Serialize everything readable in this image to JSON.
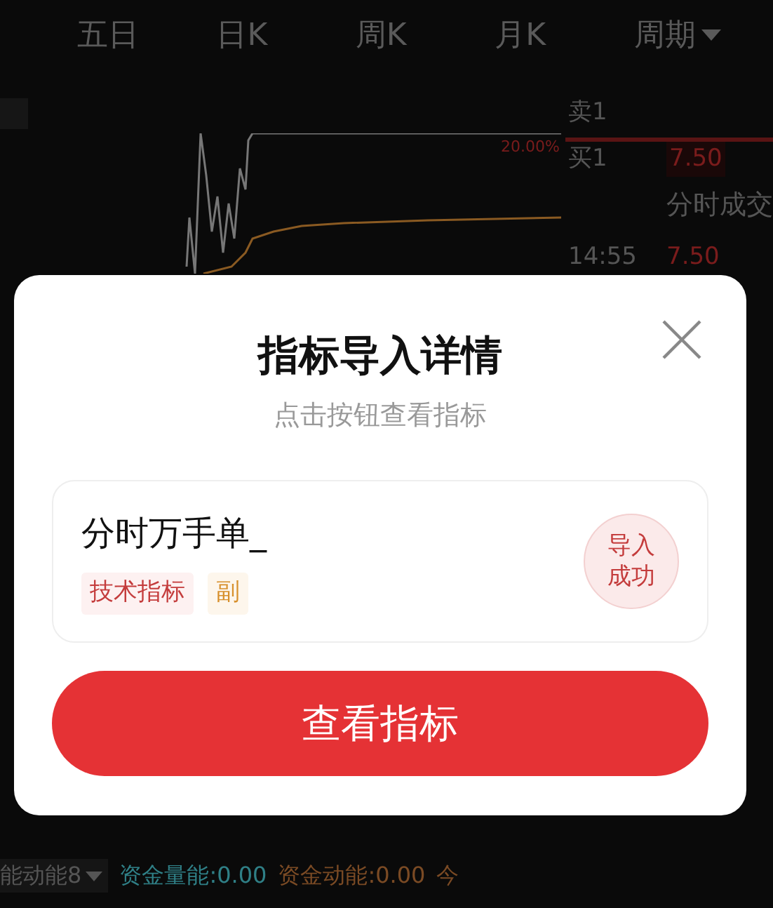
{
  "period_tabs": [
    {
      "label": "五日",
      "selected": false
    },
    {
      "label": "日K",
      "selected": false
    },
    {
      "label": "周K",
      "selected": false
    },
    {
      "label": "月K",
      "selected": false
    },
    {
      "label": "周期",
      "selected": false,
      "kind": "dropdown"
    }
  ],
  "chart": {
    "percent_label": "20.00%"
  },
  "order_book": {
    "rows": [
      {
        "label": "卖1"
      },
      {
        "label": "买1",
        "price": "7.50"
      }
    ],
    "trades_title": "分时成交",
    "trades": [
      {
        "time": "14:55",
        "price": "7.50"
      }
    ]
  },
  "dialog": {
    "title": "指标导入详情",
    "subtitle": "点击按钮查看指标",
    "indicator": {
      "name": "分时万手单_",
      "tags": [
        {
          "label": "技术指标",
          "kind": "type"
        },
        {
          "label": "副",
          "kind": "position"
        }
      ],
      "status": [
        "导入",
        "成功"
      ]
    },
    "button": "查看指标"
  },
  "indicator_bar": {
    "selector": "能动能8",
    "readings": [
      {
        "label": "资金量能:",
        "value": "0.00",
        "color": "#2f7f86"
      },
      {
        "label": "资金动能:",
        "value": "0.00",
        "color": "#7a4a24"
      }
    ],
    "trailing": "今"
  }
}
